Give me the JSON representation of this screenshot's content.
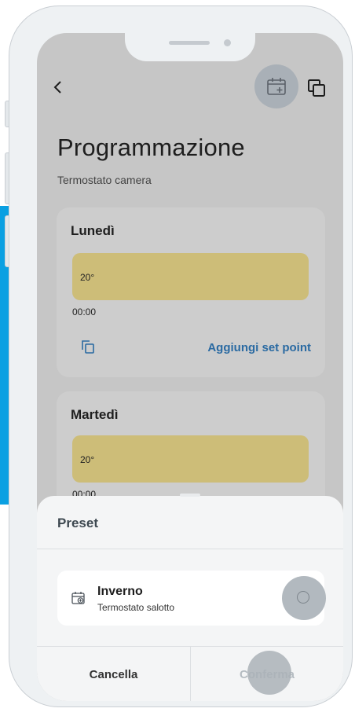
{
  "header": {
    "title": "Programmazione",
    "subtitle": "Termostato camera",
    "back_icon": "chevron-left-icon",
    "calendar_add_icon": "calendar-add-icon",
    "copy_icon": "copy-icon"
  },
  "days": [
    {
      "name": "Lunedì",
      "setpoint_temp": "20°",
      "setpoint_time": "00:00",
      "add_setpoint_label": "Aggiungi set point"
    },
    {
      "name": "Martedì",
      "setpoint_temp": "20°",
      "setpoint_time": "00:00"
    }
  ],
  "sheet": {
    "title": "Preset",
    "preset": {
      "name": "Inverno",
      "subtitle": "Termostato salotto",
      "selected": false
    },
    "cancel_label": "Cancella",
    "confirm_label": "Conferma"
  },
  "colors": {
    "overlay": "#c6c6c6",
    "setpoint_band": "#cdbd78",
    "link": "#2a6aa2",
    "accent_strip": "#0aa0e2"
  }
}
